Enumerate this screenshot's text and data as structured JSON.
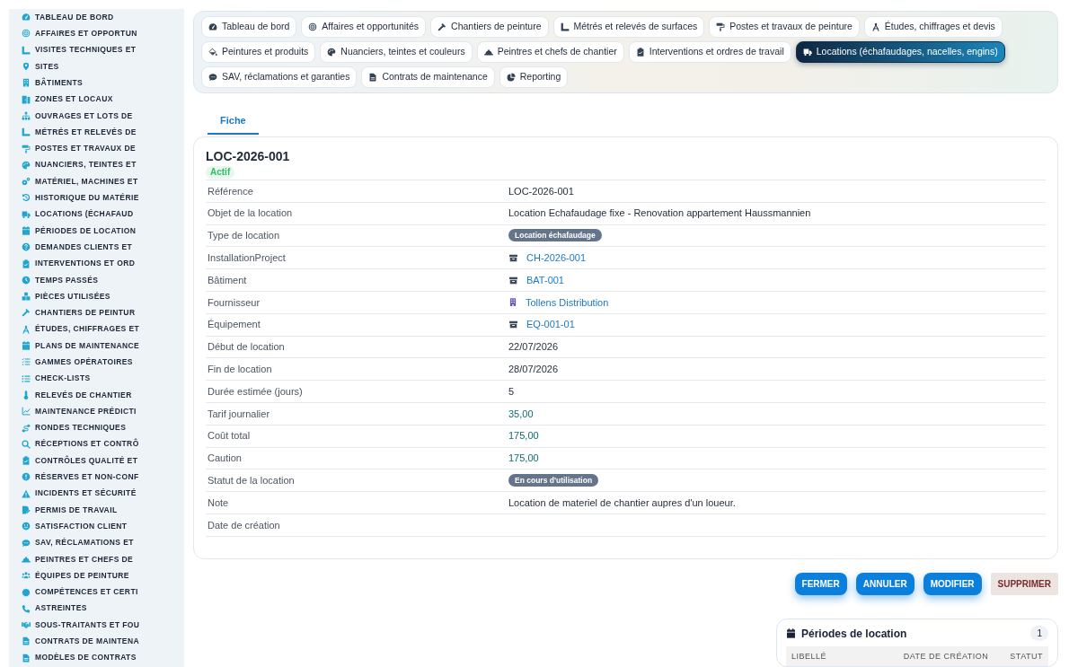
{
  "sidebar": {
    "items": [
      {
        "label": "TABLEAU DE BORD",
        "selected": false
      },
      {
        "label": "AFFAIRES ET OPPORTUN",
        "selected": false
      },
      {
        "label": "VISITES TECHNIQUES ET",
        "selected": false
      },
      {
        "label": "SITES",
        "selected": false
      },
      {
        "label": "BÂTIMENTS",
        "selected": false
      },
      {
        "label": "ZONES ET LOCAUX",
        "selected": false
      },
      {
        "label": "OUVRAGES ET LOTS DE",
        "selected": false
      },
      {
        "label": "MÉTRÉS ET RELEVÉS DE",
        "selected": false
      },
      {
        "label": "POSTES ET TRAVAUX DE",
        "selected": false
      },
      {
        "label": "NUANCIERS, TEINTES ET",
        "selected": false
      },
      {
        "label": "MATÉRIEL, MACHINES ET",
        "selected": false
      },
      {
        "label": "HISTORIQUE DU MATÉRIE",
        "selected": false
      },
      {
        "label": "LOCATIONS (ÉCHAFAUD",
        "selected": false
      },
      {
        "label": "PÉRIODES DE LOCATION",
        "selected": false
      },
      {
        "label": "DEMANDES CLIENTS ET",
        "selected": false
      },
      {
        "label": "INTERVENTIONS ET ORD",
        "selected": false
      },
      {
        "label": "TEMPS PASSÉS",
        "selected": false
      },
      {
        "label": "PIÈCES UTILISÉES",
        "selected": false
      },
      {
        "label": "CHANTIERS DE PEINTUR",
        "selected": false
      },
      {
        "label": "ÉTUDES, CHIFFRAGES ET",
        "selected": false
      },
      {
        "label": "PLANS DE MAINTENANCE",
        "selected": false
      },
      {
        "label": "GAMMES OPÉRATOIRES",
        "selected": false
      },
      {
        "label": "CHECK-LISTS",
        "selected": false
      },
      {
        "label": "RELEVÉS DE CHANTIER",
        "selected": false
      },
      {
        "label": "MAINTENANCE PRÉDICTI",
        "selected": false
      },
      {
        "label": "RONDES TECHNIQUES",
        "selected": false
      },
      {
        "label": "RÉCEPTIONS ET CONTRÔ",
        "selected": false
      },
      {
        "label": "CONTRÔLES QUALITÉ ET",
        "selected": false
      },
      {
        "label": "RÉSERVES ET NON-CONF",
        "selected": false
      },
      {
        "label": "INCIDENTS ET SÉCURITÉ",
        "selected": false
      },
      {
        "label": "PERMIS DE TRAVAIL",
        "selected": false
      },
      {
        "label": "SATISFACTION CLIENT",
        "selected": false
      },
      {
        "label": "SAV, RÉCLAMATIONS ET",
        "selected": false
      },
      {
        "label": "PEINTRES ET CHEFS DE",
        "selected": false
      },
      {
        "label": "ÉQUIPES DE PEINTURE",
        "selected": false
      },
      {
        "label": "COMPÉTENCES ET CERTI",
        "selected": false
      },
      {
        "label": "ASTREINTES",
        "selected": false
      },
      {
        "label": "SOUS-TRAITANTS ET FOU",
        "selected": false
      },
      {
        "label": "CONTRATS DE MAINTENA",
        "selected": false
      },
      {
        "label": "MODÈLES DE CONTRATS",
        "selected": false
      }
    ]
  },
  "module_tabs": [
    {
      "label": "Tableau de bord",
      "selected": false
    },
    {
      "label": "Affaires et opportunités",
      "selected": false
    },
    {
      "label": "Chantiers de peinture",
      "selected": false
    },
    {
      "label": "Métrés et relevés de surfaces",
      "selected": false
    },
    {
      "label": "Postes et travaux de peinture",
      "selected": false
    },
    {
      "label": "Études, chiffrages et devis",
      "selected": false
    },
    {
      "label": "Peintures et produits",
      "selected": false
    },
    {
      "label": "Nuanciers, teintes et couleurs",
      "selected": false
    },
    {
      "label": "Peintres et chefs de chantier",
      "selected": false
    },
    {
      "label": "Interventions et ordres de travail",
      "selected": false
    },
    {
      "label": "Locations (échafaudages, nacelles, engins)",
      "selected": true
    },
    {
      "label": "SAV, réclamations et garanties",
      "selected": false
    },
    {
      "label": "Contrats de maintenance",
      "selected": false
    },
    {
      "label": "Reporting",
      "selected": false
    }
  ],
  "record_tabs": [
    {
      "label": "Fiche",
      "selected": true
    }
  ],
  "record": {
    "title": "LOC-2026-001",
    "status": "Actif",
    "fields": [
      {
        "label": "Référence",
        "kind": "text",
        "value": "LOC-2026-001"
      },
      {
        "label": "Objet de la location",
        "kind": "text",
        "value": "Location Echafaudage fixe - Renovation appartement Haussmannien"
      },
      {
        "label": "Type de location",
        "kind": "badge",
        "value": "Location échafaudage"
      },
      {
        "label": "InstallationProject",
        "kind": "link",
        "value": "CH-2026-001"
      },
      {
        "label": "Bâtiment",
        "kind": "link",
        "value": "BAT-001"
      },
      {
        "label": "Fournisseur",
        "kind": "supplier",
        "value": "Tollens Distribution"
      },
      {
        "label": "Équipement",
        "kind": "link",
        "value": "EQ-001-01"
      },
      {
        "label": "Début de location",
        "kind": "text",
        "value": "22/07/2026"
      },
      {
        "label": "Fin de location",
        "kind": "text",
        "value": "28/07/2026"
      },
      {
        "label": "Durée estimée (jours)",
        "kind": "text",
        "value": "5"
      },
      {
        "label": "Tarif journalier",
        "kind": "money",
        "value": "35,00"
      },
      {
        "label": "Coût total",
        "kind": "money",
        "value": "175,00"
      },
      {
        "label": "Caution",
        "kind": "money",
        "value": "175,00"
      },
      {
        "label": "Statut de la location",
        "kind": "badge",
        "value": "En cours d'utilisation"
      },
      {
        "label": "Note",
        "kind": "text",
        "value": "Location de materiel de chantier aupres d'un loueur."
      },
      {
        "label": "Date de création"
      }
    ]
  },
  "actions": [
    {
      "label": "FERMER",
      "kind": "primary"
    },
    {
      "label": "ANNULER",
      "kind": "primary"
    },
    {
      "label": "MODIFIER",
      "kind": "primary"
    },
    {
      "label": "SUPPRIMER",
      "kind": "danger"
    }
  ],
  "related_panel": {
    "title": "Périodes de location",
    "count": "1",
    "columns": [
      "LIBELLÉ",
      "DATE DE CRÉATION",
      "STATUT"
    ]
  }
}
